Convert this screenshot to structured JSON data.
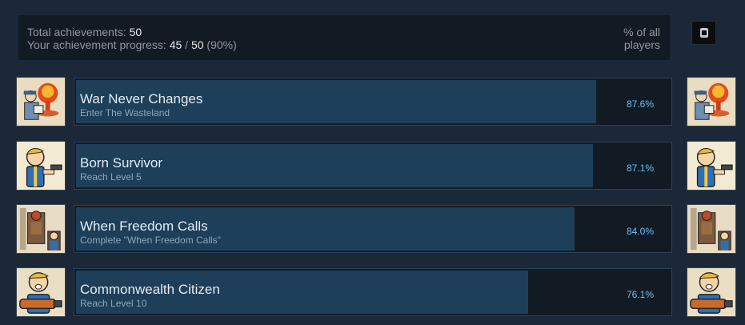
{
  "summary": {
    "total_label": "Total achievements: ",
    "total_value": "50",
    "progress_label": "Your achievement progress: ",
    "progress_done": "45",
    "progress_sep": " / ",
    "progress_total": "50",
    "progress_pct": " (90%)",
    "pct_header_line1": "% of all",
    "pct_header_line2": "players"
  },
  "achievements": [
    {
      "title": "War Never Changes",
      "description": "Enter The Wasteland",
      "percent_label": "87.6%",
      "percent": 87.6,
      "icon": "nuke-explosion-icon"
    },
    {
      "title": "Born Survivor",
      "description": "Reach Level 5",
      "percent_label": "87.1%",
      "percent": 87.1,
      "icon": "vault-boy-pistol-icon"
    },
    {
      "title": "When Freedom Calls",
      "description": "Complete \"When Freedom Calls\"",
      "percent_label": "84.0%",
      "percent": 84.0,
      "icon": "power-armor-icon"
    },
    {
      "title": "Commonwealth Citizen",
      "description": "Reach Level 10",
      "percent_label": "76.1%",
      "percent": 76.1,
      "icon": "vault-boy-flamer-icon"
    }
  ],
  "colors": {
    "background": "#1b2838",
    "bar_fill": "#1e3f59",
    "percent_text": "#66c0f4"
  }
}
